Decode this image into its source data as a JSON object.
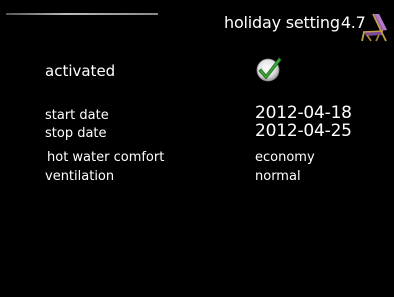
{
  "header": {
    "title": "holiday setting",
    "menu_number": "4.7",
    "icon": "deck-chair-icon"
  },
  "settings": {
    "activated": {
      "label": "activated",
      "checked": true,
      "icon": "checkmark-icon"
    },
    "start_date": {
      "label": "start date",
      "value": "2012-04-18"
    },
    "stop_date": {
      "label": "stop date",
      "value": "2012-04-25"
    },
    "hot_water_comfort": {
      "label": "hot water comfort",
      "value": "economy"
    },
    "ventilation": {
      "label": "ventilation",
      "value": "normal"
    }
  },
  "colors": {
    "background": "#000000",
    "text": "#ffffff",
    "check_green": "#3da33a",
    "chair_purple": "#9a5fb0"
  }
}
